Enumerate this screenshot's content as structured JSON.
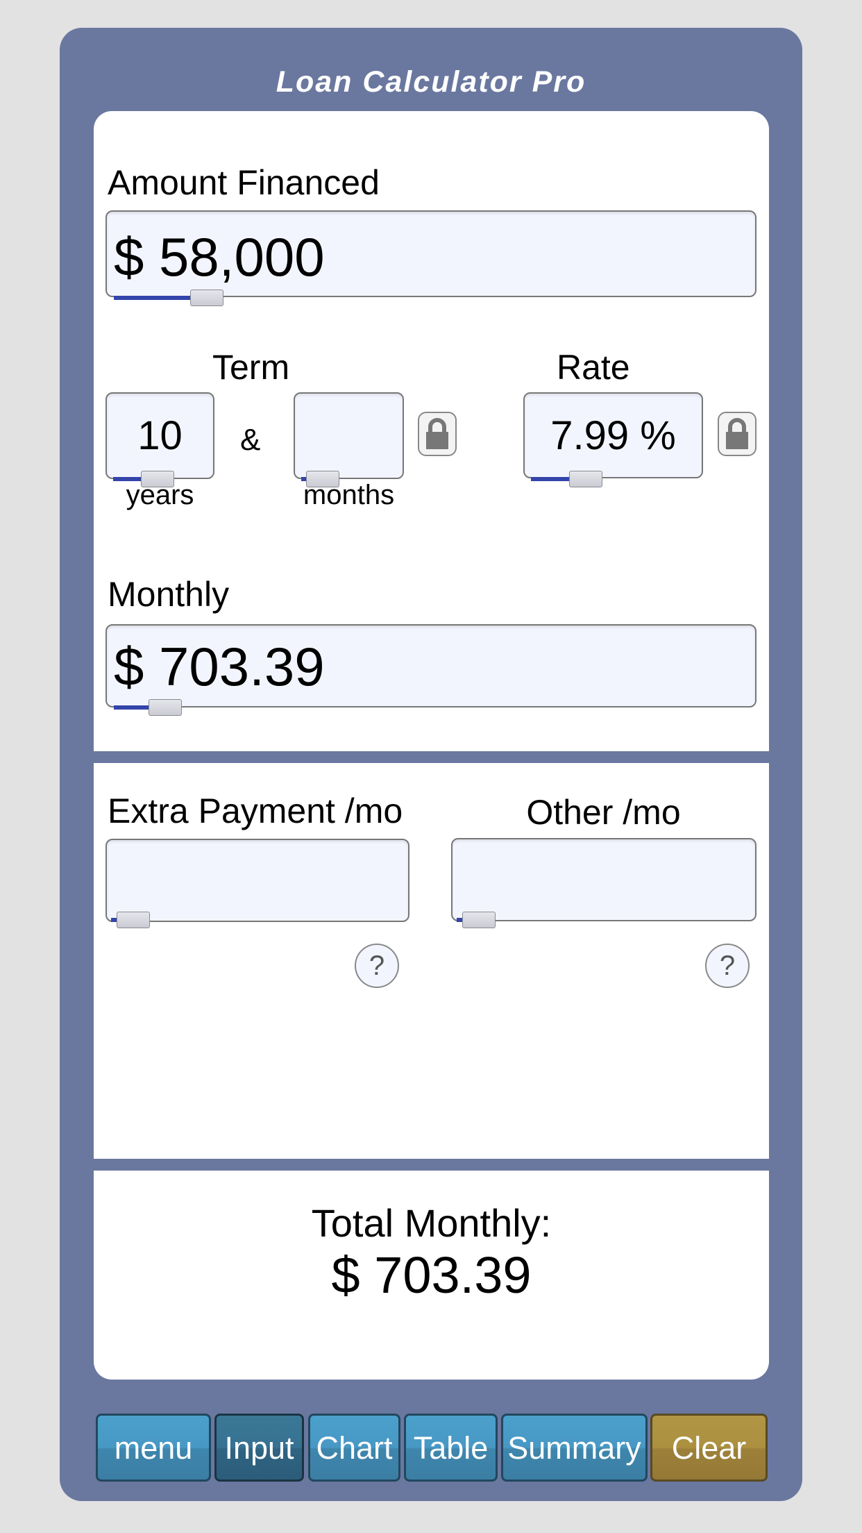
{
  "app": {
    "title": "Loan Calculator Pro"
  },
  "amount": {
    "label": "Amount Financed",
    "value": "$ 58,000",
    "slider_fraction": 0.12
  },
  "term": {
    "label": "Term",
    "years": {
      "value": "10",
      "unit": "years",
      "slider_fraction": 0.18
    },
    "separator": "&",
    "months": {
      "value": "",
      "unit": "months",
      "slider_fraction": 0.0
    },
    "lock_icon": "lock-icon"
  },
  "rate": {
    "label": "Rate",
    "value": "7.99 %",
    "slider_fraction": 0.22,
    "lock_icon": "lock-icon"
  },
  "monthly": {
    "label": "Monthly",
    "value": "$ 703.39",
    "slider_fraction": 0.05
  },
  "extra": {
    "label": "Extra Payment /mo",
    "value": "",
    "help": "?",
    "slider_fraction": 0.0
  },
  "other": {
    "label": "Other /mo",
    "value": "",
    "help": "?",
    "slider_fraction": 0.0
  },
  "total": {
    "label": "Total Monthly:",
    "value": "$ 703.39"
  },
  "toolbar": {
    "buttons": [
      {
        "label": "menu",
        "active": false
      },
      {
        "label": "Input",
        "active": true
      },
      {
        "label": "Chart",
        "active": false
      },
      {
        "label": "Table",
        "active": false
      },
      {
        "label": "Summary",
        "active": false
      },
      {
        "label": "Clear",
        "active": false
      }
    ]
  },
  "colors": {
    "frame": "#6a78a0",
    "field_bg": "#f3f5fe",
    "slider_fill": "#3344aa",
    "button_blue": "#4898c4",
    "button_active": "#367191",
    "button_clear": "#ab9040"
  }
}
